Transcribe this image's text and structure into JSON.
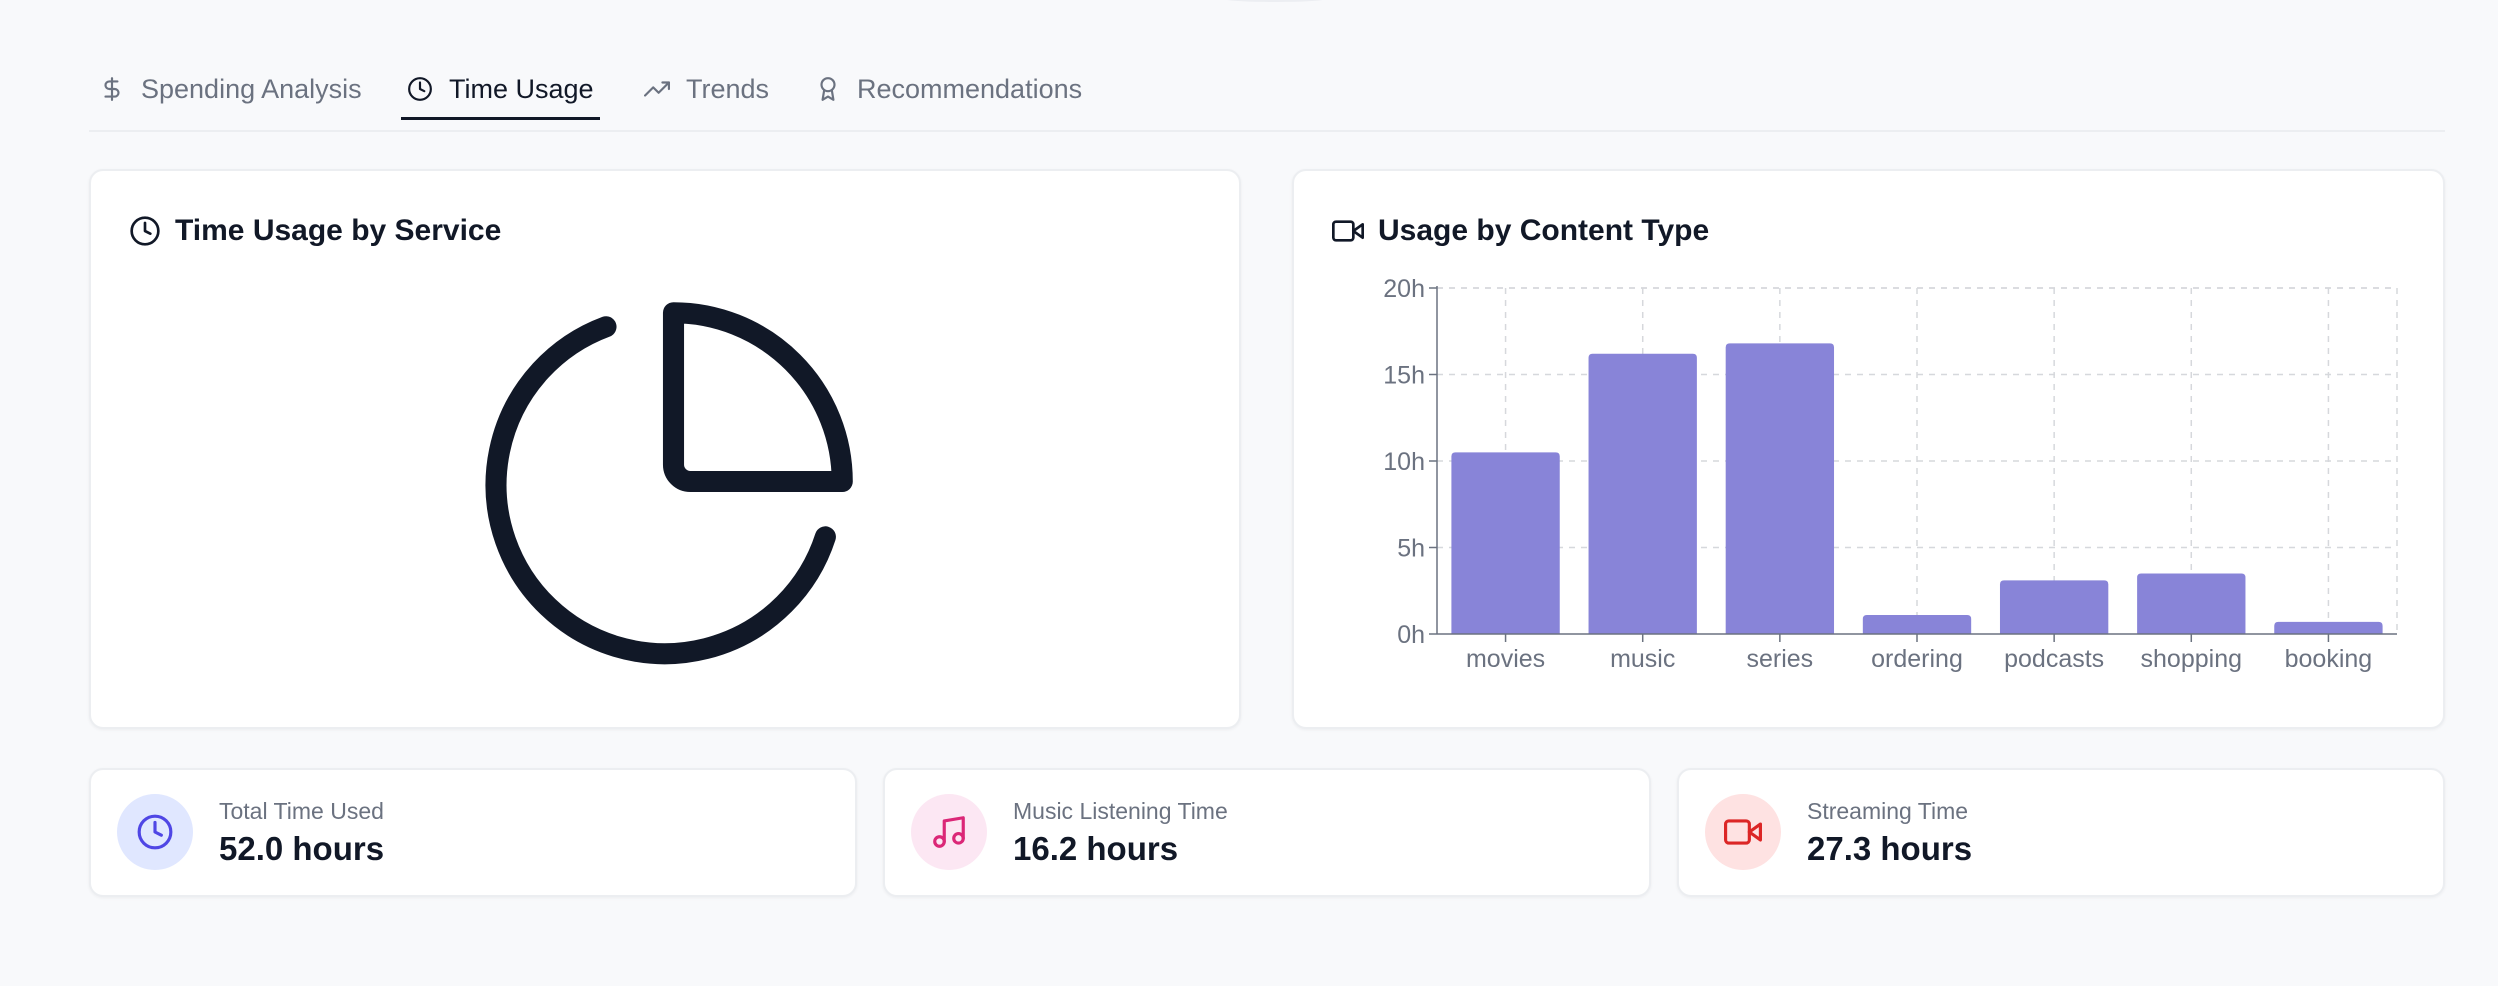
{
  "tabs": [
    {
      "label": "Spending Analysis",
      "icon": "dollar-icon"
    },
    {
      "label": "Time Usage",
      "icon": "clock-icon"
    },
    {
      "label": "Trends",
      "icon": "trending-up-icon"
    },
    {
      "label": "Recommendations",
      "icon": "award-icon"
    }
  ],
  "active_tab": "Time Usage",
  "service_card": {
    "title": "Time Usage by Service",
    "icon": "clock-icon",
    "placeholder_icon": "pie-chart-icon"
  },
  "content_card": {
    "title": "Usage by Content Type",
    "icon": "video-icon"
  },
  "chart_data": {
    "type": "bar",
    "categories": [
      "movies",
      "music",
      "series",
      "ordering",
      "podcasts",
      "shopping",
      "booking"
    ],
    "values": [
      10.5,
      16.2,
      16.8,
      1.1,
      3.1,
      3.5,
      0.7
    ],
    "ylim": [
      0,
      20
    ],
    "yticks": [
      0,
      5,
      10,
      15,
      20
    ],
    "ytick_suffix": "h",
    "grid": true,
    "bar_color": "#8884d8"
  },
  "stats": [
    {
      "label": "Total Time Used",
      "value": "52.0 hours",
      "icon": "clock-icon",
      "icon_color": "#4f46e5",
      "bg_color": "#e0e7ff"
    },
    {
      "label": "Music Listening Time",
      "value": "16.2 hours",
      "icon": "music-icon",
      "icon_color": "#db2777",
      "bg_color": "#fce7f3"
    },
    {
      "label": "Streaming Time",
      "value": "27.3 hours",
      "icon": "video-icon",
      "icon_color": "#dc2626",
      "bg_color": "#fee2e2"
    }
  ]
}
